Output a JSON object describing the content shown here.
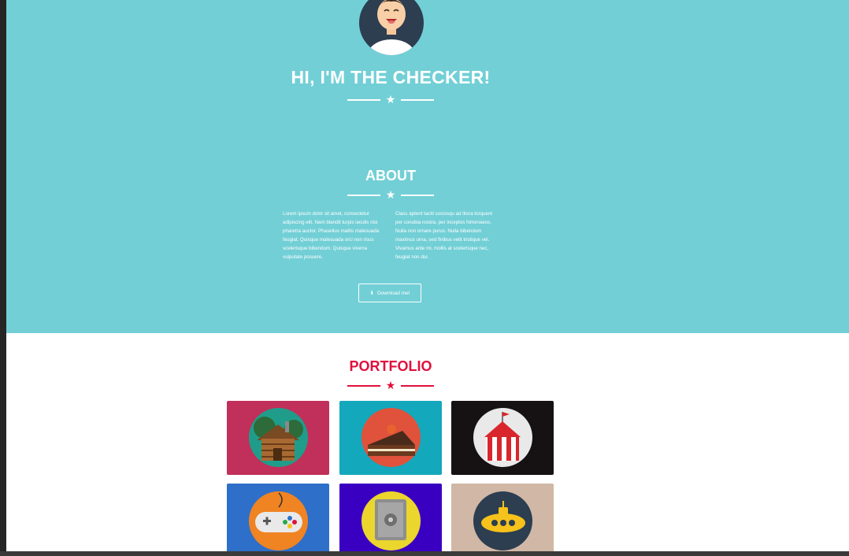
{
  "hero": {
    "title": "HI, I'M THE CHECKER!"
  },
  "about": {
    "title": "ABOUT",
    "col_left": "Lorem ipsum dolor sit amet, consectetur adipiscing elit. Nam blandit turpis iaculis nisi pharetra auctor. Phasellus mattis malesuada feugiat. Quisque malesuada orci non risus scelerisque bibendum. Quisque viverra vulputate posuere.",
    "col_right": "Class aptent taciti sociosqu ad litora torquent per conubia nostra, per inceptos himenaeos. Nulla non ornare purus. Nulla bibendum maximus urna, sed finibus velit tristique vel. Vivamus ante mi, mollis at scelerisque nec, feugiat non dui.",
    "download_label": "Download me!"
  },
  "portfolio": {
    "title": "PORTFOLIO",
    "items": [
      {
        "icon": "cabin-icon",
        "bg": "#c0305a"
      },
      {
        "icon": "cake-icon",
        "bg": "#14a8bd"
      },
      {
        "icon": "circus-tent-icon",
        "bg": "#161214"
      },
      {
        "icon": "game-controller-icon",
        "bg": "#2e6fc9"
      },
      {
        "icon": "safe-icon",
        "bg": "#3a00c2"
      },
      {
        "icon": "submarine-icon",
        "bg": "#d1b7a5"
      }
    ]
  },
  "colors": {
    "hero_bg": "#72cfd6",
    "accent": "#e0103d",
    "white": "#ffffff"
  }
}
